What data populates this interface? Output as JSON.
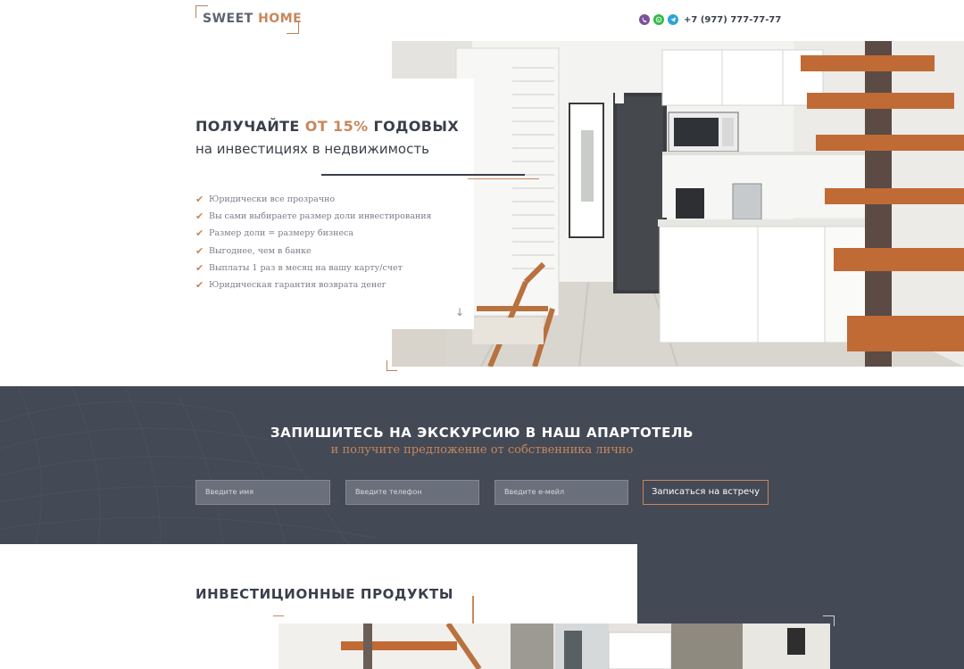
{
  "header": {
    "logo_word1": "SWEET",
    "logo_word2": "HOME",
    "phone": "+7 (977) 777-77-77",
    "messenger_icons": [
      "viber-icon",
      "whatsapp-icon",
      "telegram-icon"
    ]
  },
  "hero": {
    "title_prefix": "ПОЛУЧАЙТЕ",
    "title_accent": "ОТ 15%",
    "title_suffix": "ГОДОВЫХ",
    "subtitle": "на инвестициях в недвижимость",
    "features": [
      "Юридически все прозрачно",
      "Вы сами выбираете размер доли инвестирования",
      "Размер доли = размеру бизнеса",
      "Выгоднее, чем в банке",
      "Выплаты 1 раз в месяц на вашу карту/счет",
      "Юридическая гарантия возврата денег"
    ],
    "check_glyph": "✔",
    "scroll_arrow": "↓"
  },
  "booking": {
    "title": "ЗАПИШИТЕСЬ НА ЭКСКУРСИЮ В НАШ АПАРТОТЕЛЬ",
    "subtitle": "и получите предложение от собственника лично",
    "name_placeholder": "Введите имя",
    "phone_placeholder": "Введите телефон",
    "email_placeholder": "Введите е-мейл",
    "button_label": "Записаться на встречу"
  },
  "products": {
    "title": "ИНВЕСТИЦИОННЫЕ ПРОДУКТЫ"
  },
  "colors": {
    "accent": "#c8875c",
    "dark": "#3a3f4b",
    "band": "#434955",
    "muted": "#7a7f88"
  }
}
